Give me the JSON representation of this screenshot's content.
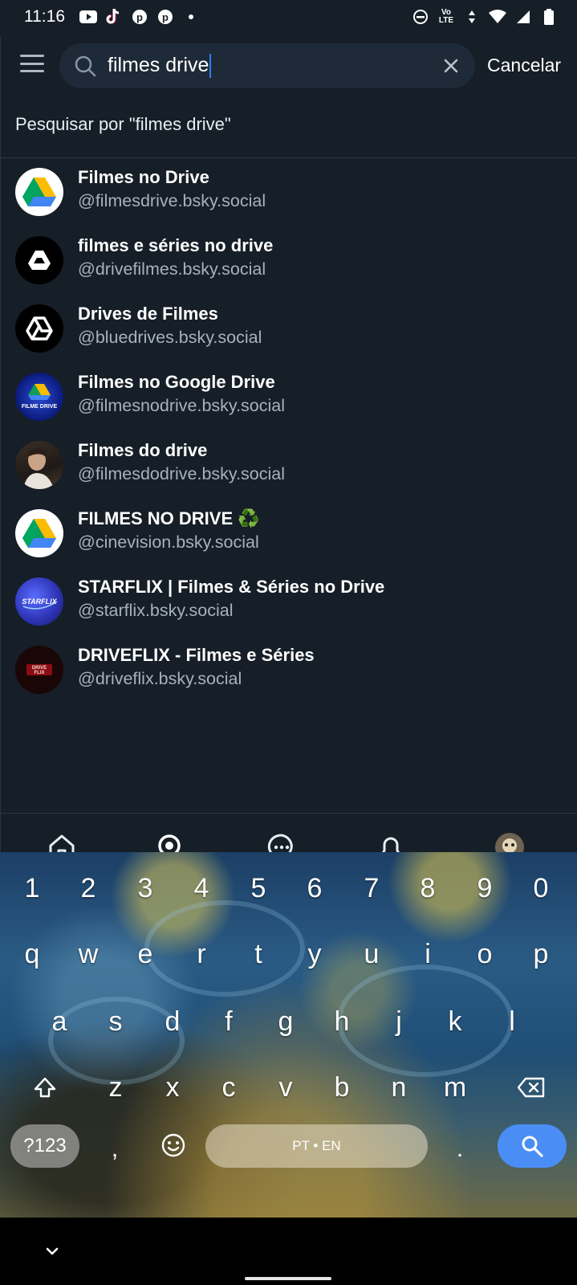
{
  "status_bar": {
    "time": "11:16",
    "volte": "Vo LTE",
    "icons": [
      "youtube-icon",
      "tiktok-icon",
      "pinterest-icon",
      "pinterest-icon",
      "dot-icon",
      "dnd-icon",
      "volte-icon",
      "data-arrows-icon",
      "wifi-icon",
      "signal-icon",
      "battery-icon"
    ]
  },
  "header": {
    "search_value": "filmes drive",
    "cancel_label": "Cancelar"
  },
  "suggestion": "Pesquisar por \"filmes drive\"",
  "results": [
    {
      "name": "Filmes no Drive",
      "handle": "@filmesdrive.bsky.social",
      "avatar": "google-drive-color"
    },
    {
      "name": "filmes e séries no drive",
      "handle": "@drivefilmes.bsky.social",
      "avatar": "drive-white-on-black"
    },
    {
      "name": "Drives de Filmes",
      "handle": "@bluedrives.bsky.social",
      "avatar": "drive-outline-on-black"
    },
    {
      "name": "Filmes no Google Drive",
      "handle": "@filmesnodrive.bsky.social",
      "avatar": "filme-drive-logo"
    },
    {
      "name": "Filmes do drive",
      "handle": "@filmesdodrive.bsky.social",
      "avatar": "person-photo"
    },
    {
      "name": "FILMES NO DRIVE ♻️",
      "handle": "@cinevision.bsky.social",
      "avatar": "google-drive-color"
    },
    {
      "name": "STARFLIX | Filmes & Séries no Drive",
      "handle": "@starflix.bsky.social",
      "avatar": "starflix-logo"
    },
    {
      "name": "DRIVEFLIX - Filmes e Séries",
      "handle": "@driveflix.bsky.social",
      "avatar": "driveflix-logo"
    }
  ],
  "avatar_text": {
    "filme_drive": "FILME DRIVE",
    "starflix": "STARFLIX",
    "driveflix": "DRIVE FLIX"
  },
  "nav": [
    "home-icon",
    "search-icon",
    "chat-icon",
    "bell-icon",
    "profile-avatar"
  ],
  "keyboard": {
    "row_numbers": [
      "1",
      "2",
      "3",
      "4",
      "5",
      "6",
      "7",
      "8",
      "9",
      "0"
    ],
    "row1": [
      "q",
      "w",
      "e",
      "r",
      "t",
      "y",
      "u",
      "i",
      "o",
      "p"
    ],
    "row2": [
      "a",
      "s",
      "d",
      "f",
      "g",
      "h",
      "j",
      "k",
      "l"
    ],
    "row3": [
      "z",
      "x",
      "c",
      "v",
      "b",
      "n",
      "m"
    ],
    "symbols_label": "?123",
    "comma": ",",
    "space_label": "PT • EN",
    "period": ".",
    "accent_color": "#4a8ef5"
  }
}
